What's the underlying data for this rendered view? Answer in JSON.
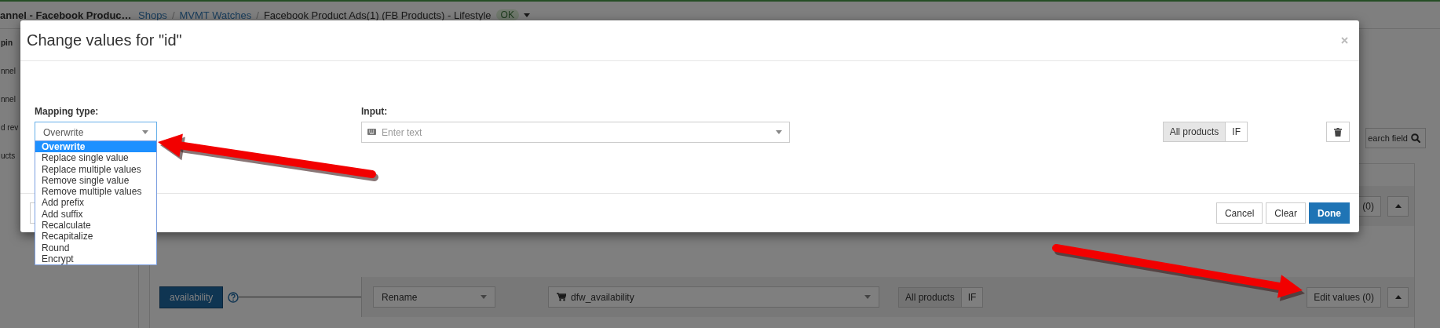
{
  "topbar": {
    "channel_title": "annel - Facebook Produc…",
    "separator": "/",
    "breadcrumb": [
      {
        "label": "Shops",
        "kind": "link"
      },
      {
        "label": "MVMT Watches",
        "kind": "link"
      },
      {
        "label": "Facebook Product Ads(1) (FB Products) - Lifestyle",
        "kind": "current"
      }
    ],
    "status_badge": "OK"
  },
  "sidebar": {
    "items": [
      {
        "label": "pin",
        "selected": true
      },
      {
        "label": "nnel",
        "selected": false
      },
      {
        "label": "nnel",
        "selected": false
      },
      {
        "label": "d rev",
        "selected": false
      },
      {
        "label": "ucts",
        "selected": false
      }
    ]
  },
  "toolbar": {
    "search_button": "earch field"
  },
  "mapping_rows": [
    {
      "kind": "partial",
      "edit_button": "(0)"
    },
    {
      "kind": "full",
      "field": "availability",
      "mapping_type": "Rename",
      "input": "dfw_availability",
      "scope": [
        {
          "label": "All products",
          "selected": true
        },
        {
          "label": "IF",
          "selected": false
        }
      ],
      "edit_button": "Edit values (0)"
    }
  ],
  "modal": {
    "title": "Change values for \"id\"",
    "mapping_type": {
      "label": "Mapping type:",
      "value": "Overwrite",
      "options": [
        {
          "label": "Overwrite",
          "selected": true
        },
        {
          "label": "Replace single value",
          "selected": false
        },
        {
          "label": "Replace multiple values",
          "selected": false
        },
        {
          "label": "Remove single value",
          "selected": false
        },
        {
          "label": "Remove multiple values",
          "selected": false
        },
        {
          "label": "Add prefix",
          "selected": false
        },
        {
          "label": "Add suffix",
          "selected": false
        },
        {
          "label": "Recalculate",
          "selected": false
        },
        {
          "label": "Recapitalize",
          "selected": false
        },
        {
          "label": "Round",
          "selected": false
        },
        {
          "label": "Encrypt",
          "selected": false
        }
      ]
    },
    "input": {
      "label": "Input:",
      "placeholder": "Enter text"
    },
    "scope": [
      {
        "label": "All products",
        "selected": true
      },
      {
        "label": "IF",
        "selected": false
      }
    ],
    "footer_buttons": [
      {
        "label": "Cancel",
        "kind": "default"
      },
      {
        "label": "Clear",
        "kind": "default"
      },
      {
        "label": "Done",
        "kind": "primary"
      }
    ]
  }
}
